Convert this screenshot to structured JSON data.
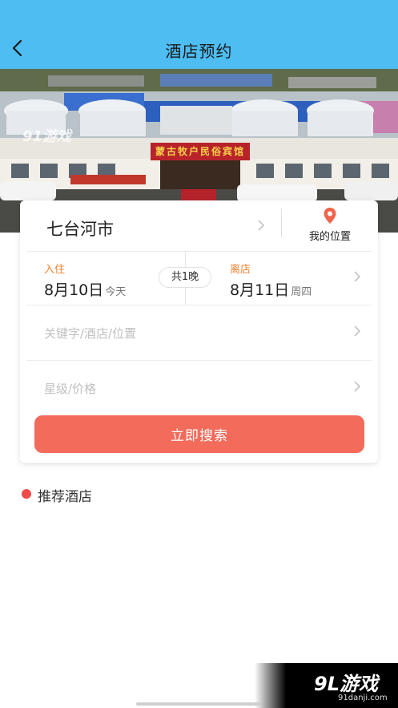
{
  "header": {
    "title": "酒店预约",
    "back_icon": "back-arrow-icon",
    "bg_color": "#4dbdf2"
  },
  "hero": {
    "watermark": "91游戏",
    "sign_text": "蒙古牧户民俗宾馆"
  },
  "search_card": {
    "city": "七台河市",
    "my_location_label": "我的位置",
    "checkin": {
      "label": "入住",
      "date": "8月10日",
      "sub": "今天"
    },
    "nights": "共1晚",
    "checkout": {
      "label": "离店",
      "date": "8月11日",
      "sub": "周四"
    },
    "keyword_placeholder": "关键字/酒店/位置",
    "star_price_placeholder": "星级/价格",
    "search_button": "立即搜索",
    "accent_color": "#f26b5b",
    "date_label_color": "#f08030"
  },
  "recommended": {
    "title": "推荐酒店",
    "dot_color": "#ef4b4b"
  },
  "badge": {
    "logo": "9L游戏",
    "url": "91danji.com"
  }
}
